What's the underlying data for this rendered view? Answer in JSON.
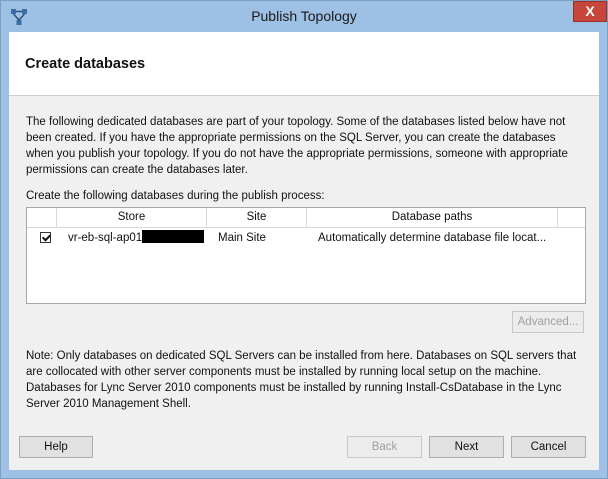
{
  "window": {
    "title": "Publish Topology",
    "close_label": "X"
  },
  "header": {
    "title": "Create databases"
  },
  "description": "The following dedicated databases are part of your topology. Some of the databases listed below have not been created. If you have the appropriate permissions on the SQL Server, you can create the databases when you publish your topology. If you do not have the appropriate permissions, someone with appropriate permissions can create the databases later.",
  "prompt": "Create the following databases during the publish process:",
  "grid": {
    "columns": [
      "Store",
      "Site",
      "Database paths"
    ],
    "rows": [
      {
        "checked": true,
        "store": "vr-eb-sql-ap01",
        "site": "Main Site",
        "paths": "Automatically determine database file locat..."
      }
    ]
  },
  "buttons": {
    "advanced": "Advanced...",
    "help": "Help",
    "back": "Back",
    "next": "Next",
    "cancel": "Cancel"
  },
  "note": "Note: Only databases on dedicated SQL Servers can be installed from here. Databases on SQL servers that are collocated with other server components must be installed by running local setup on the machine. Databases for Lync Server 2010 components must be installed by running Install-CsDatabase in the Lync Server 2010 Management Shell."
}
